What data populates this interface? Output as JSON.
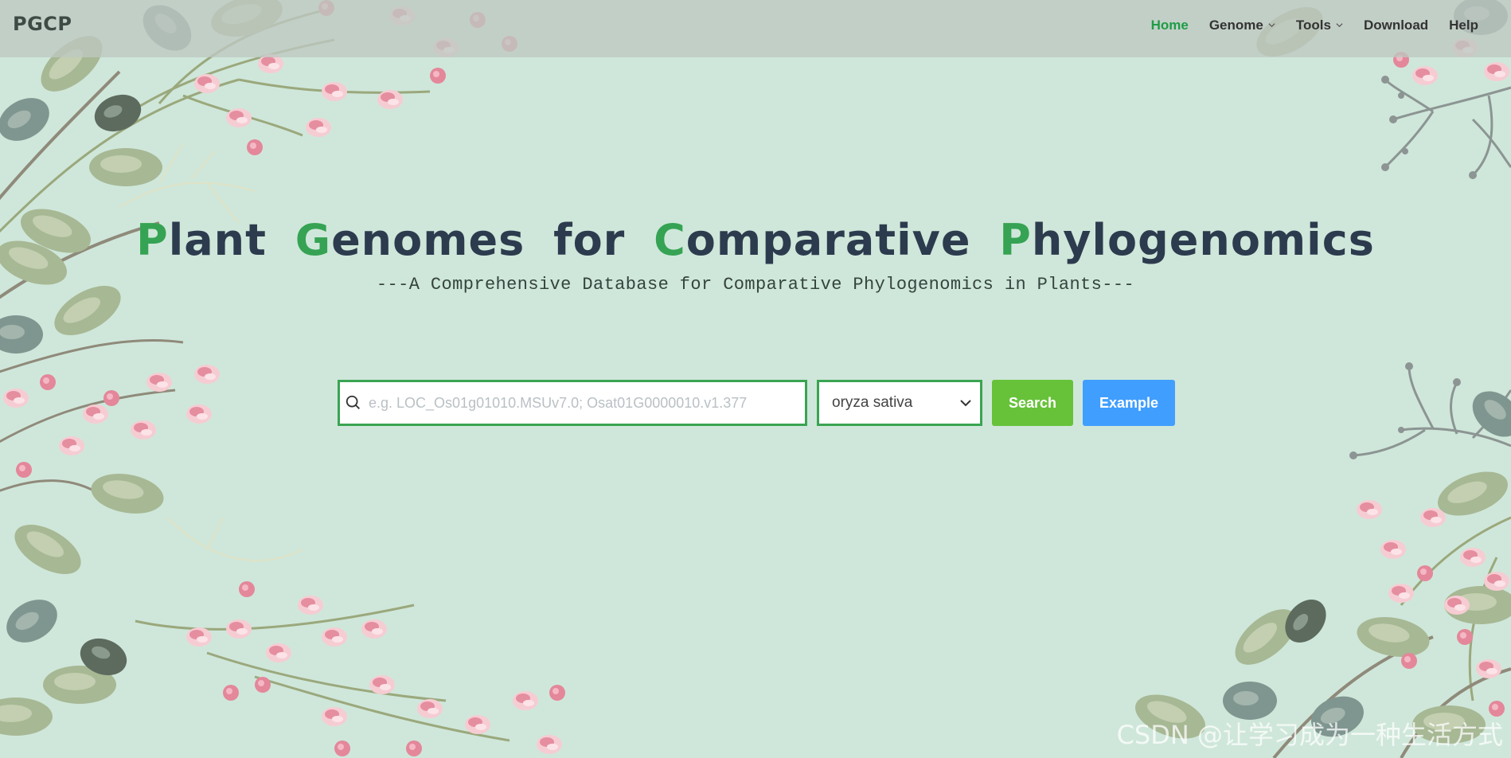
{
  "brand": "PGCP",
  "nav": {
    "items": [
      {
        "label": "Home",
        "active": true,
        "dropdown": false
      },
      {
        "label": "Genome",
        "active": false,
        "dropdown": true
      },
      {
        "label": "Tools",
        "active": false,
        "dropdown": true
      },
      {
        "label": "Download",
        "active": false,
        "dropdown": false
      },
      {
        "label": "Help",
        "active": false,
        "dropdown": false
      }
    ]
  },
  "hero": {
    "title_words": [
      {
        "cap": "P",
        "rest": "lant"
      },
      {
        "cap": "G",
        "rest": "enomes"
      },
      {
        "cap": "",
        "rest": "for"
      },
      {
        "cap": "C",
        "rest": "omparative"
      },
      {
        "cap": "P",
        "rest": "hylogenomics"
      }
    ],
    "subtitle": "---A Comprehensive Database for Comparative Phylogenomics in Plants---"
  },
  "search": {
    "placeholder": "e.g. LOC_Os01g01010.MSUv7.0; Osat01G0000010.v1.377",
    "value": "",
    "species_selected": "oryza sativa",
    "search_label": "Search",
    "example_label": "Example"
  },
  "watermark": "CSDN @让学习成为一种生活方式",
  "colors": {
    "background": "#cfe7da",
    "accent_green": "#35a353",
    "nav_active": "#1e9d46",
    "search_button": "#67c23a",
    "example_button": "#409eff",
    "title_dark": "#2d3b4e"
  },
  "icons": {
    "search": "search-icon",
    "dropdown": "chevron-down-icon"
  }
}
